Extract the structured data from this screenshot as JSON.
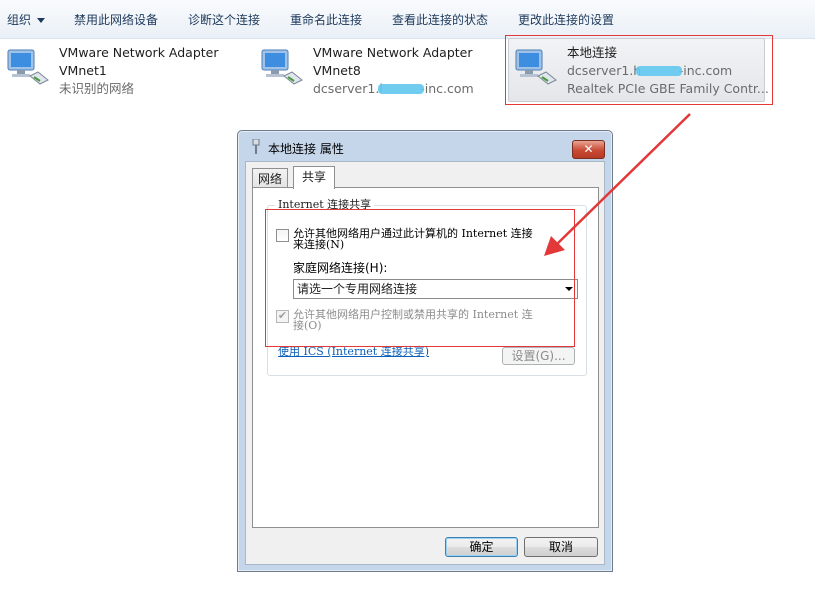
{
  "toolbar": {
    "organize": "组织",
    "disable_device": "禁用此网络设备",
    "diagnose": "诊断这个连接",
    "rename": "重命名此连接",
    "view_status": "查看此连接的状态",
    "change_settings": "更改此连接的设置"
  },
  "adapters": [
    {
      "name": "VMware Network Adapter",
      "line2": "VMnet1",
      "line3": "未识别的网络"
    },
    {
      "name": "VMware Network Adapter",
      "line2": "VMnet8",
      "line3": "dcserver1.l   -inc.com"
    },
    {
      "name": "本地连接",
      "line2": "dcserver1.h   -inc.com",
      "line3": "Realtek PCIe GBE Family Contr..."
    }
  ],
  "dialog": {
    "title": "本地连接 属性",
    "close_glyph": "✕",
    "tabs": [
      "网络",
      "共享"
    ],
    "group_label": "Internet 连接共享",
    "option1_line1": "允许其他网络用户通过此计算机的 Internet 连接",
    "option1_line2": "来连接(N)",
    "home_network_label": "家庭网络连接(H):",
    "home_network_value": "请选一个专用网络连接",
    "option2_line1": "允许其他网络用户控制或禁用共享的 Internet 连",
    "option2_line2": "接(O)",
    "ics_link": "使用 ICS (Internet 连接共享)",
    "settings_button": "设置(G)...",
    "ok_button": "确定",
    "cancel_button": "取消"
  },
  "colors": {
    "annotation_red": "#e2383a",
    "link_blue": "#0b5fb8"
  }
}
